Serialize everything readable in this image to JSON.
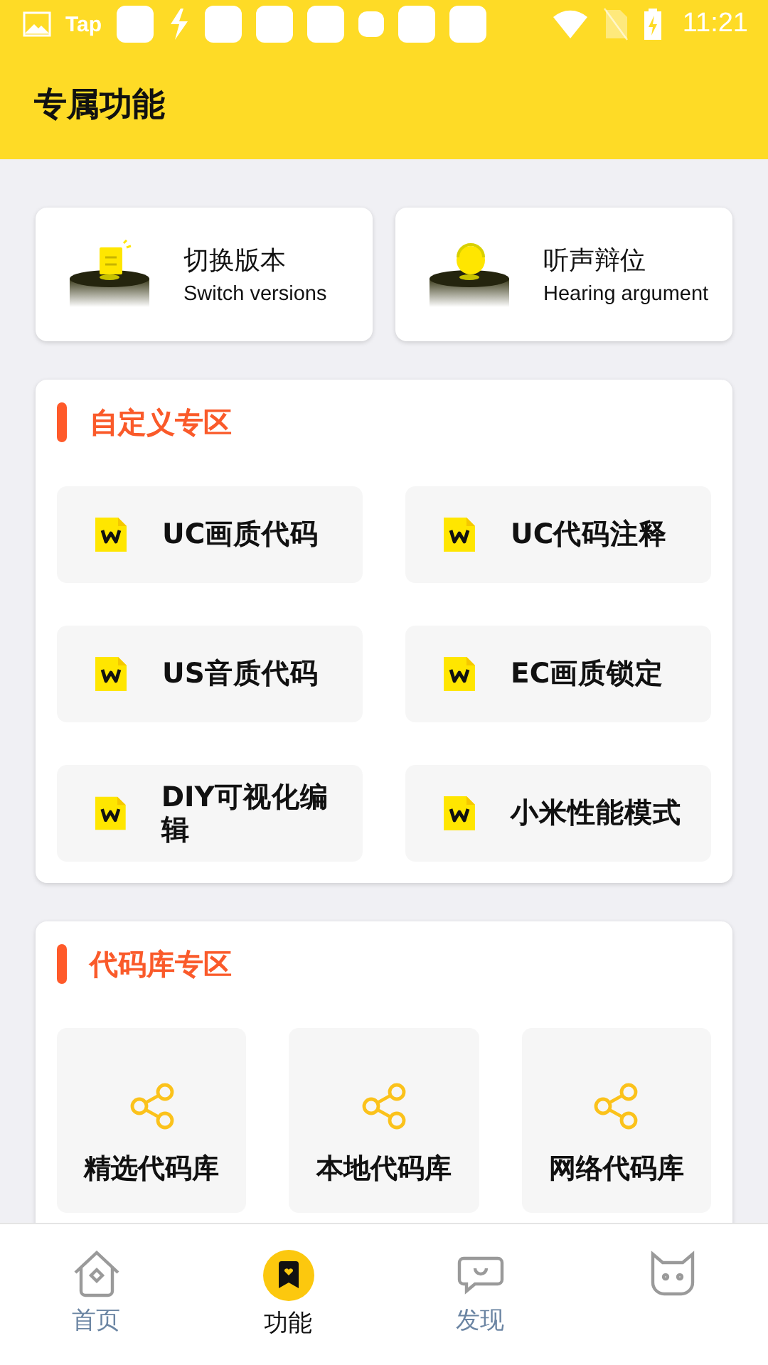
{
  "status_bar": {
    "carrier_text": "Tap",
    "time": "11:21"
  },
  "header": {
    "title": "专属功能"
  },
  "quick_cards": [
    {
      "kind": "document",
      "title": "切换版本",
      "subtitle": "Switch versions"
    },
    {
      "kind": "mascot",
      "title": "听声辩位",
      "subtitle": "Hearing argument"
    }
  ],
  "custom_section": {
    "title": "自定义专区",
    "items": [
      "UC画质代码",
      "UC代码注释",
      "US音质代码",
      "EC画质锁定",
      "DIY可视化编辑",
      "小米性能模式"
    ]
  },
  "library_section": {
    "title": "代码库专区",
    "items": [
      "精选代码库",
      "本地代码库",
      "网络代码库"
    ]
  },
  "bottom_nav": [
    {
      "kind": "home",
      "label": "首页",
      "selected": false
    },
    {
      "kind": "bookmark",
      "label": "功能",
      "selected": true
    },
    {
      "kind": "chat",
      "label": "发现",
      "selected": false
    },
    {
      "kind": "cat",
      "selected": false
    }
  ]
}
